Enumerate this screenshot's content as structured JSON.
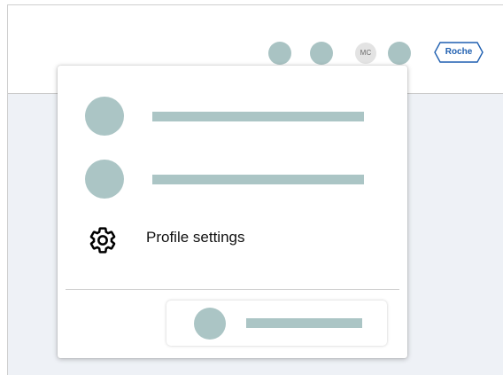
{
  "header": {
    "avatar_initials": "MC",
    "logo_text": "Roche"
  },
  "menu": {
    "settings_label": "Profile settings"
  },
  "colors": {
    "placeholder": "#abc5c5",
    "logo": "#1f5fb0",
    "content_background": "#eef1f6"
  },
  "icons": {
    "settings": "gear-icon"
  }
}
